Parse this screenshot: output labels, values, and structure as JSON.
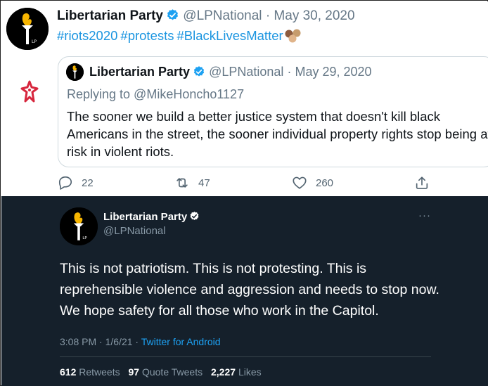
{
  "tweet": {
    "author_name": "Libertarian Party",
    "handle": "@LPNational",
    "separator": "·",
    "date": "May 30, 2020",
    "hashtags": [
      "#riots2020",
      "#protests",
      "#BlackLivesMatter"
    ],
    "emoji_icon": "raised-fists-emoji",
    "quoted": {
      "author_name": "Libertarian Party",
      "handle": "@LPNational",
      "separator": "·",
      "date": "May 29, 2020",
      "replying_to": "Replying to @MikeHoncho1127",
      "text": "The sooner we build a better justice system that doesn't kill black Americans in the street, the sooner individual property rights stop being at risk in violent riots."
    },
    "actions": {
      "replies": "22",
      "retweets": "47",
      "likes": "260"
    }
  },
  "dark_tweet": {
    "author_name": "Libertarian Party",
    "handle": "@LPNational",
    "more_label": "···",
    "text": "This is not patriotism. This is not protesting. This is reprehensible violence and aggression and needs to stop now. We hope safety for all those who work in the Capitol.",
    "time": "3:08 PM",
    "date": "1/6/21",
    "meta_separator": "·",
    "source": "Twitter for Android",
    "stats": {
      "retweets_count": "612",
      "retweets_label": "Retweets",
      "quotes_count": "97",
      "quotes_label": "Quote Tweets",
      "likes_count": "2,227",
      "likes_label": "Likes"
    }
  },
  "colors": {
    "link_blue": "#1b95e0",
    "dark_bg": "#15202b",
    "muted_gray": "#657786",
    "verified_blue": "#1da1f2",
    "mark_red": "#d7263d"
  }
}
